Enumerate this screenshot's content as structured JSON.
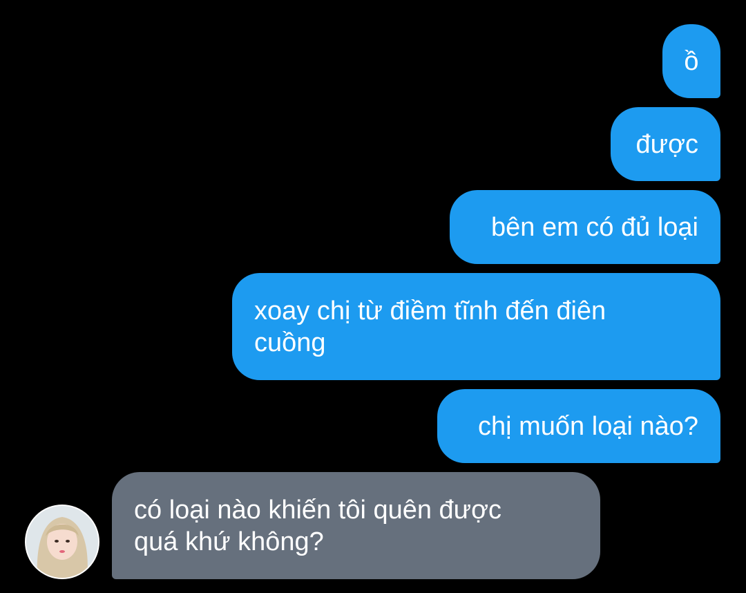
{
  "messages": {
    "sent": [
      "ồ",
      "được",
      "bên em có đủ loại",
      "xoay chị từ điềm tĩnh đến điên cuồng",
      "chị muốn loại nào?"
    ],
    "received": [
      "có loại nào khiến tôi quên được quá khứ không?"
    ]
  },
  "colors": {
    "background": "#000000",
    "sent_bubble": "#1d9bf0",
    "received_bubble": "#66707d",
    "text": "#ffffff"
  },
  "icons": {
    "contact_avatar": "avatar"
  }
}
